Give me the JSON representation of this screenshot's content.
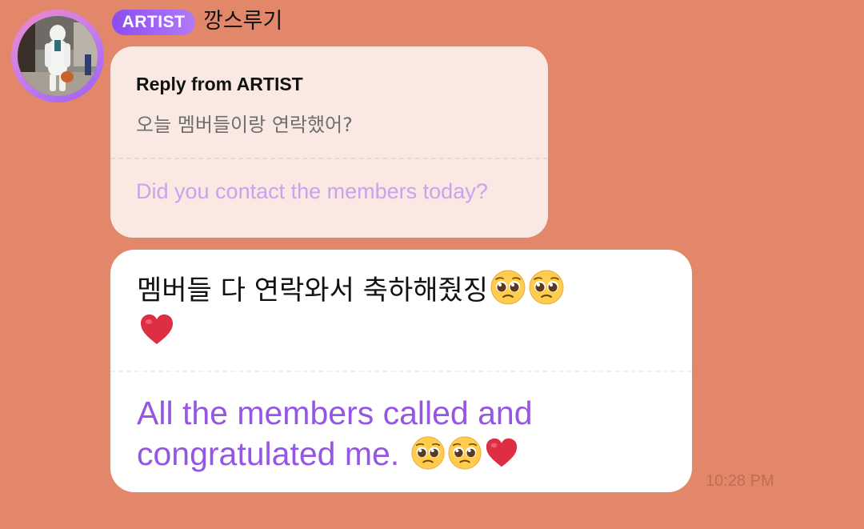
{
  "header": {
    "badge": "ARTIST",
    "name": "깡스루기"
  },
  "reply": {
    "title": "Reply from ARTIST",
    "original_text": "오늘 멤버들이랑 연락했어?",
    "translation": "Did you contact the members today?"
  },
  "message": {
    "original_text": "멤버들 다 연락와서 축하해줬징",
    "translation": "All the members called and congratulated me.",
    "emoji_korean": [
      "pleading-face",
      "pleading-face",
      "red-heart"
    ],
    "emoji_translation": [
      "pleading-face",
      "pleading-face",
      "red-heart"
    ]
  },
  "timestamp": "10:28 PM",
  "colors": {
    "background": "#E3876A",
    "badge_start": "#8B4DF0",
    "badge_end": "#B27AF7",
    "reply_bubble": "#FAE8E2",
    "reply_translation": "#C9A3EE",
    "message_translation": "#9556E4",
    "timestamp": "#C06B55"
  }
}
